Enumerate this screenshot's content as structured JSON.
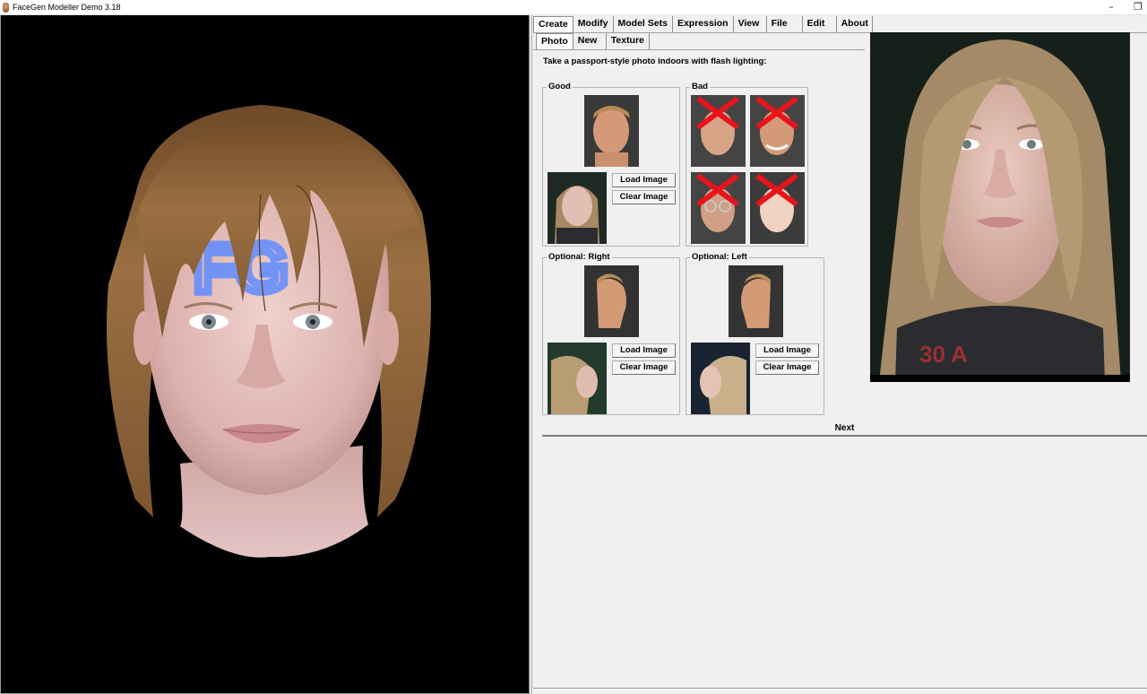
{
  "window": {
    "title": "FaceGen Modeller Demo 3.18",
    "minimize_glyph": "–",
    "restore_glyph": "❐"
  },
  "main_tabs": [
    {
      "label": "Create",
      "active": true
    },
    {
      "label": "Modify",
      "active": false
    },
    {
      "label": "Model Sets",
      "active": false
    },
    {
      "label": "Expression",
      "active": false
    },
    {
      "label": "View",
      "active": false
    },
    {
      "label": "File",
      "active": false
    },
    {
      "label": "Edit",
      "active": false
    },
    {
      "label": "About",
      "active": false
    }
  ],
  "sub_tabs": [
    {
      "label": "Photo",
      "active": true
    },
    {
      "label": "New",
      "active": false
    },
    {
      "label": "Texture",
      "active": false
    }
  ],
  "instruction": "Take a passport-style photo indoors with flash lighting:",
  "groups": {
    "good": {
      "label": "Good"
    },
    "bad": {
      "label": "Bad"
    },
    "optional_right": {
      "label": "Optional: Right"
    },
    "optional_left": {
      "label": "Optional: Left"
    }
  },
  "buttons": {
    "load": "Load Image",
    "clear": "Clear Image"
  },
  "next_label": "Next",
  "colors": {
    "viewport_bg": "#000000",
    "panel_bg": "#f0f0f0",
    "bad_cross": "#e8141c",
    "hair": "#8a6238",
    "skin": "#e7c2bd",
    "fg_logo": "#5f8cff"
  }
}
